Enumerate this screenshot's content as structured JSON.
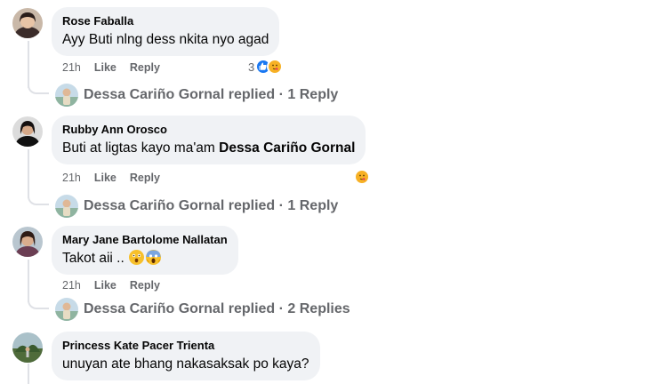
{
  "comments": [
    {
      "author": "Rose Faballa",
      "text": "Ayy Buti nlng dess nkita nyo agad",
      "time": "21h",
      "like": "Like",
      "reply": "Reply",
      "reaction_count": "3",
      "reactions": [
        "like-icon",
        "care-icon"
      ],
      "replies": "Dessa Cariño Gornal replied · 1 Reply"
    },
    {
      "author": "Rubby Ann Orosco",
      "text_prefix": "Buti at ligtas kayo ma'am ",
      "mention": "Dessa Cariño Gornal",
      "time": "21h",
      "like": "Like",
      "reply": "Reply",
      "reactions": [
        "care-icon"
      ],
      "replies": "Dessa Cariño Gornal replied · 1 Reply"
    },
    {
      "author": "Mary Jane Bartolome Nallatan",
      "text": "Takot aii .. ",
      "emojis": [
        "astonished-face-icon",
        "screaming-face-icon"
      ],
      "time": "21h",
      "like": "Like",
      "reply": "Reply",
      "replies": "Dessa Cariño Gornal replied · 2 Replies"
    },
    {
      "author": "Princess Kate Pacer Trienta",
      "text": "unuyan ate bhang nakasaksak po kaya?"
    }
  ],
  "colors": {
    "bubble": "#f0f2f5",
    "meta": "#65676b",
    "like_blue": "#1877f2",
    "care_yellow": "#f7b125"
  }
}
